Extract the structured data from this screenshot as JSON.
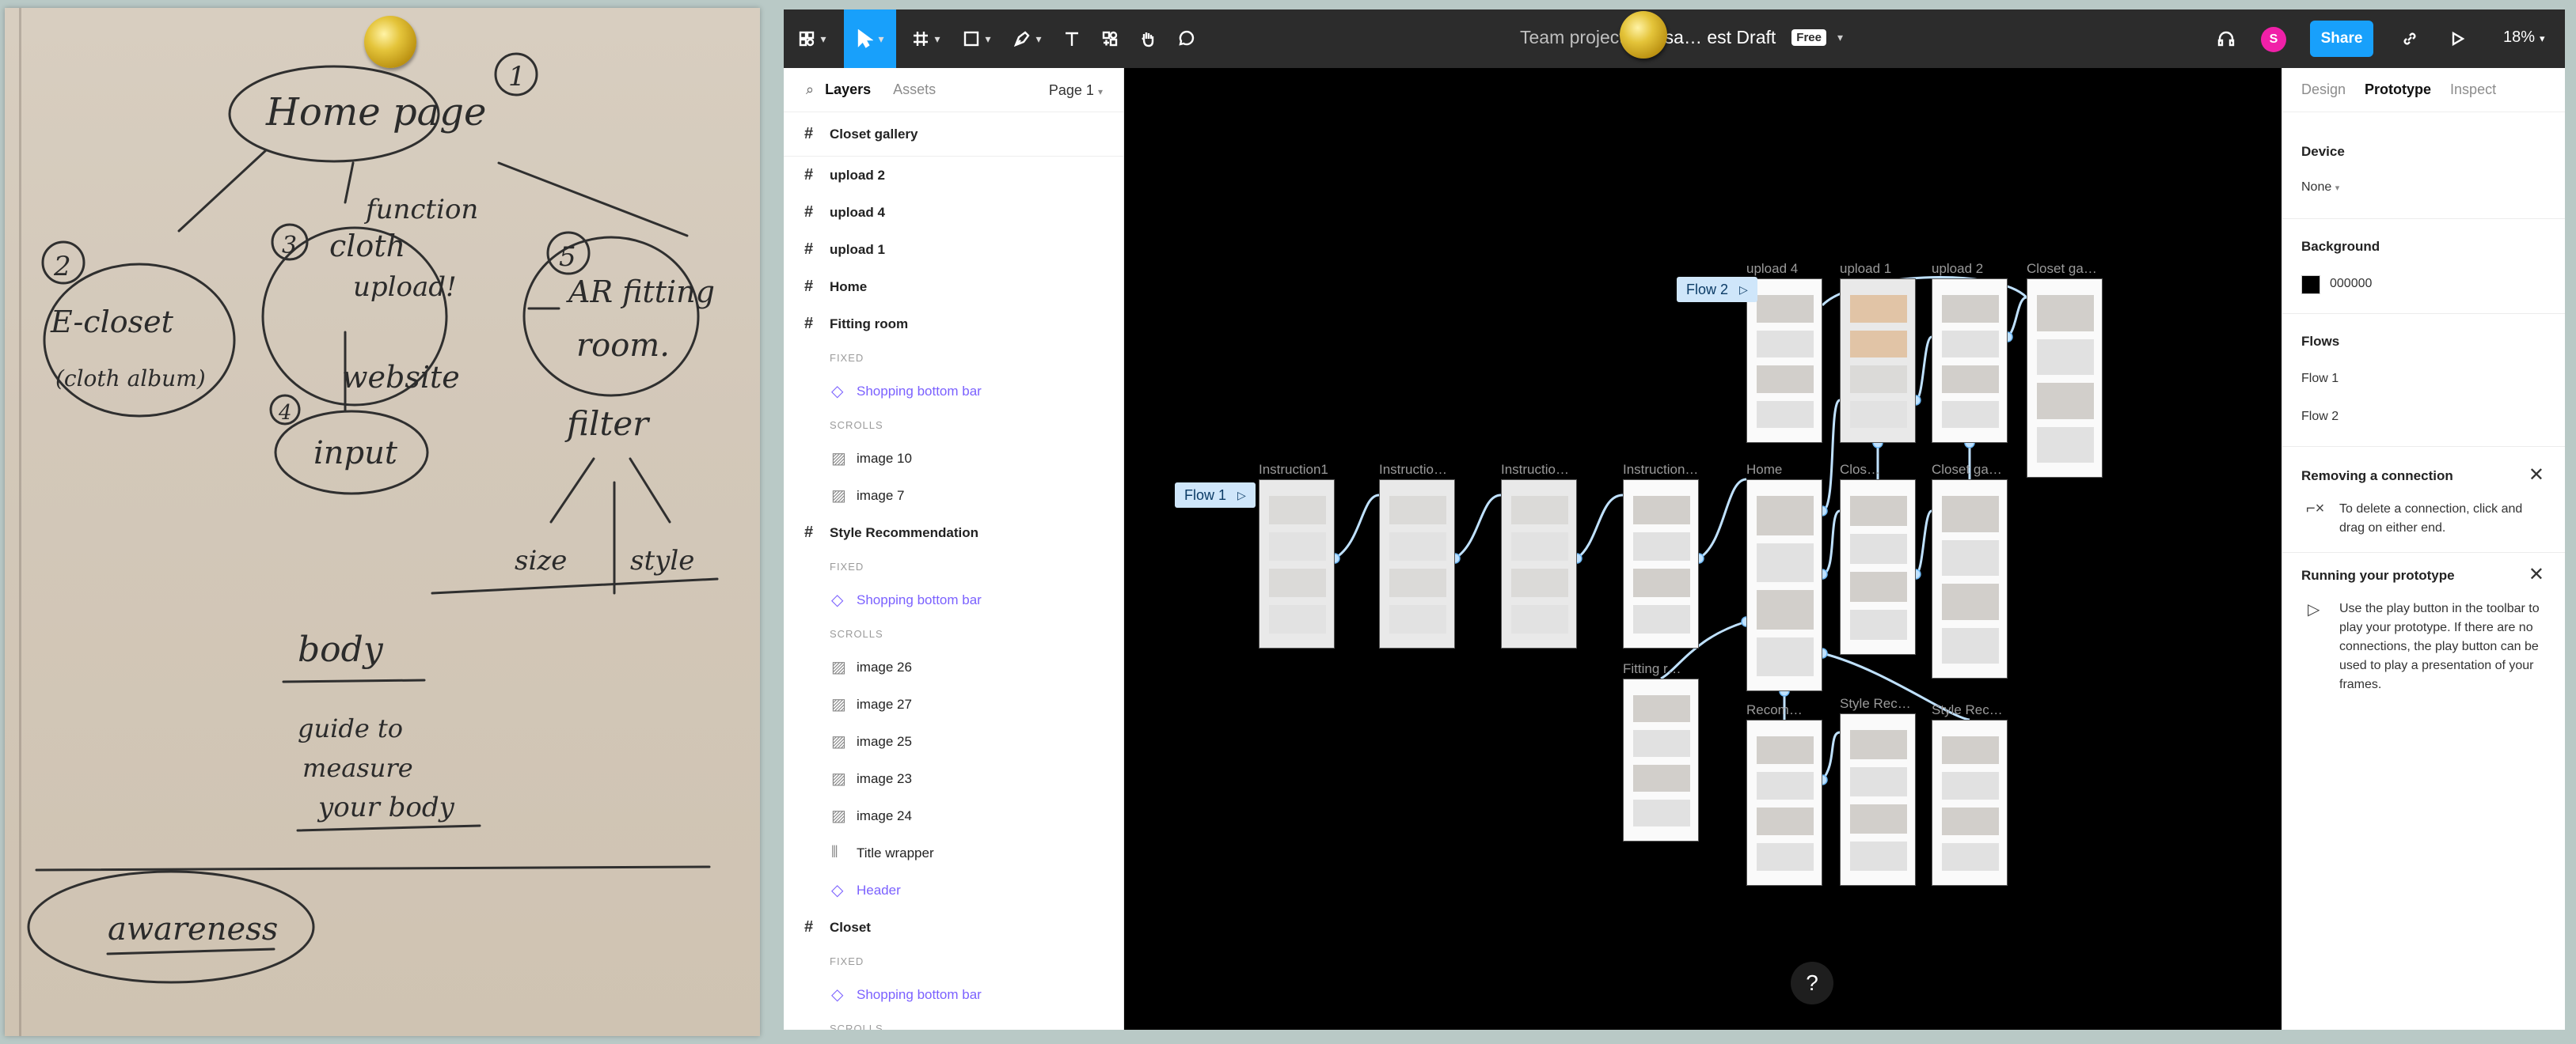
{
  "sketch": {
    "home_page": "Home page",
    "num1": "1",
    "num2": "2",
    "num3": "3",
    "num4": "4",
    "num5": "5",
    "e_closet": "E-closet",
    "cloth_album": "(cloth album)",
    "function": "function",
    "cloth": "cloth",
    "upload": "upload!",
    "website": "website",
    "input": "input",
    "ar_fitting": "AR fitting",
    "room": "room.",
    "filter": "filter",
    "size": "size",
    "style": "style",
    "body": "body",
    "guide_to": "guide to",
    "measure": "measure",
    "your_body": "your body",
    "awareness": "awareness"
  },
  "toolbar": {
    "breadcrumb_project": "Team project",
    "breadcrumb_sep": "/",
    "file_name": "Usa… est Draft",
    "badge": "Free",
    "avatar_letter": "S",
    "share_label": "Share",
    "zoom": "18%"
  },
  "left_panel": {
    "tabs": [
      "Layers",
      "Assets"
    ],
    "page": "Page 1",
    "layers": [
      {
        "kind": "frame",
        "label": "Closet gallery"
      },
      {
        "kind": "frame",
        "label": "upload 2"
      },
      {
        "kind": "frame",
        "label": "upload 4"
      },
      {
        "kind": "frame",
        "label": "upload 1"
      },
      {
        "kind": "frame",
        "label": "Home"
      },
      {
        "kind": "frame",
        "label": "Fitting room"
      },
      {
        "kind": "section",
        "label": "FIXED"
      },
      {
        "kind": "component",
        "label": "Shopping bottom bar"
      },
      {
        "kind": "section",
        "label": "SCROLLS"
      },
      {
        "kind": "image",
        "label": "image 10"
      },
      {
        "kind": "image",
        "label": "image 7"
      },
      {
        "kind": "frame",
        "label": "Style Recommendation"
      },
      {
        "kind": "section",
        "label": "FIXED"
      },
      {
        "kind": "component",
        "label": "Shopping bottom bar"
      },
      {
        "kind": "section",
        "label": "SCROLLS"
      },
      {
        "kind": "image",
        "label": "image 26"
      },
      {
        "kind": "image",
        "label": "image 27"
      },
      {
        "kind": "image",
        "label": "image 25"
      },
      {
        "kind": "image",
        "label": "image 23"
      },
      {
        "kind": "image",
        "label": "image 24"
      },
      {
        "kind": "group",
        "label": "Title wrapper"
      },
      {
        "kind": "component",
        "label": "Header"
      },
      {
        "kind": "frame",
        "label": "Closet"
      },
      {
        "kind": "section",
        "label": "FIXED"
      },
      {
        "kind": "component",
        "label": "Shopping bottom bar"
      },
      {
        "kind": "section",
        "label": "SCROLLS"
      }
    ]
  },
  "canvas": {
    "flow1": "Flow 1",
    "flow2": "Flow 2",
    "frames": [
      "Instruction1",
      "Instructio…",
      "Instructio…",
      "Instruction…",
      "upload 4",
      "upload 1",
      "upload 2",
      "Closet ga…",
      "Home",
      "Clos…",
      "Closet ga…",
      "Fitting r…",
      "Recom…",
      "Style Rec…",
      "Style Rec…"
    ]
  },
  "right_panel": {
    "tabs": [
      "Design",
      "Prototype",
      "Inspect"
    ],
    "device_label": "Device",
    "device_value": "None",
    "background_label": "Background",
    "background_value": "000000",
    "flows_label": "Flows",
    "flows": [
      "Flow 1",
      "Flow 2"
    ],
    "removing_title": "Removing a connection",
    "removing_text": "To delete a connection, click and drag on either end.",
    "running_title": "Running your prototype",
    "running_text": "Use the play button in the toolbar to play your prototype. If there are no connections, the play button can be used to play a presentation of your frames.",
    "help": "?"
  },
  "colors": {
    "toolbar_bg": "#2c2c2c",
    "accent": "#18a0fb",
    "canvas_bg": "#000000",
    "component_purple": "#7b61ff",
    "connection": "#bfe1ff"
  }
}
